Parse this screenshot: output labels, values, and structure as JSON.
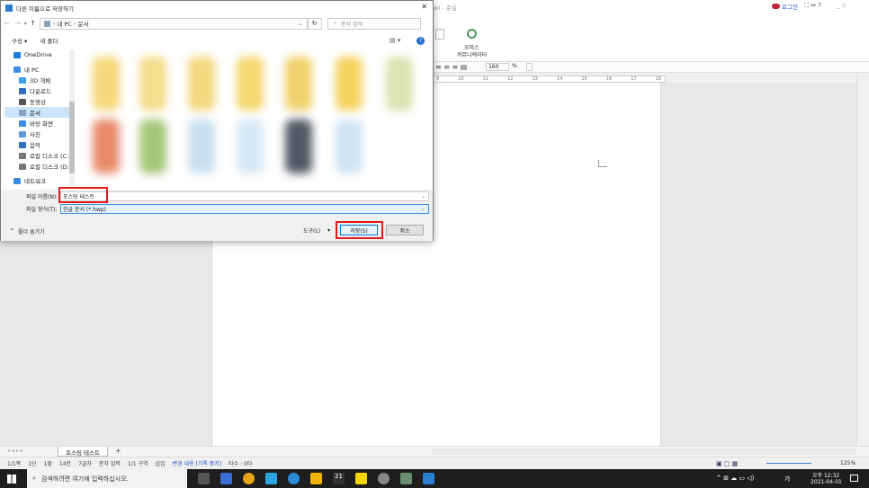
{
  "app": {
    "title_fragment": "wi - 준실",
    "login_label": "로그인",
    "ribbon_label_1": "오피스",
    "ribbon_label_2": "커뮤니케이터",
    "zoom_value": "160",
    "zoom_unit": "%",
    "ruler_ticks": [
      "9",
      "10",
      "11",
      "12",
      "13",
      "14",
      "15",
      "16",
      "17",
      "18"
    ]
  },
  "doc_tab": {
    "label": "포스팅 테스트",
    "add_label": "+"
  },
  "statusbar": {
    "items": [
      "1/1쪽",
      "1단",
      "1줄",
      "14칸",
      "7글자",
      "문자 입력",
      "1/1 구역",
      "삽입",
      "변경 내용 [기록 중지]",
      "타수 : 0타"
    ],
    "zoom": "125%"
  },
  "taskbar": {
    "search_placeholder": "검색하려면 여기에 입력하십시오.",
    "time": "오후 12:32",
    "date": "2021-04-01",
    "ime": "가"
  },
  "dialog": {
    "title": "다른 이름으로 저장하기",
    "breadcrumb": [
      "내 PC",
      "문서"
    ],
    "search_placeholder": "문서 검색",
    "organize_label": "구성 ▾",
    "new_folder_label": "새 폴더",
    "nav_items": [
      {
        "label": "OneDrive",
        "icon": "cloud-icon",
        "color": "#1e7ad6"
      },
      {
        "label": "내 PC",
        "icon": "pc-icon",
        "color": "#3a8ee6"
      },
      {
        "label": "3D 개체",
        "icon": "cube-icon",
        "color": "#3aa0e6"
      },
      {
        "label": "다운로드",
        "icon": "download-icon",
        "color": "#2f6fbf"
      },
      {
        "label": "동영상",
        "icon": "video-icon",
        "color": "#555555"
      },
      {
        "label": "문서",
        "icon": "document-icon",
        "color": "#8aa3c2"
      },
      {
        "label": "바탕 화면",
        "icon": "desktop-icon",
        "color": "#3a8ee6"
      },
      {
        "label": "사진",
        "icon": "picture-icon",
        "color": "#5a9bd6"
      },
      {
        "label": "음악",
        "icon": "music-icon",
        "color": "#2f6fbf"
      },
      {
        "label": "로컬 디스크 (C:)",
        "icon": "disk-icon",
        "color": "#777777"
      },
      {
        "label": "로컬 디스크 (D:)",
        "icon": "disk-icon",
        "color": "#777777"
      },
      {
        "label": "네트워크",
        "icon": "network-icon",
        "color": "#3a8ee6"
      }
    ],
    "filename_label": "파일 이름(N):",
    "filename_value": "포스팅 테스트",
    "filetype_label": "파일 형식(T):",
    "filetype_value": "한글 문서 (*.hwp)",
    "hide_folders_label": "폴더 숨기기",
    "tools_label": "도구(L)",
    "save_label": "저장(S)",
    "cancel_label": "취소",
    "close_glyph": "✕",
    "help_glyph": "?"
  }
}
